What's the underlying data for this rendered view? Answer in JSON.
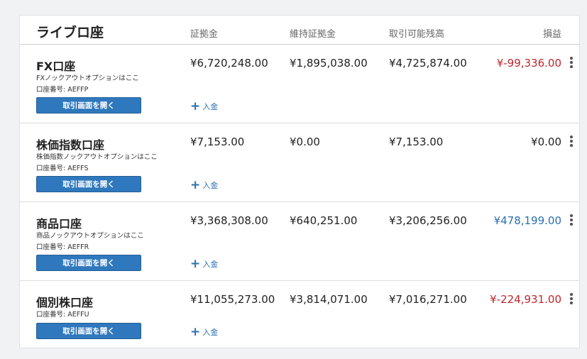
{
  "header": {
    "title": "ライブロ座",
    "col_margin": "証拠金",
    "col_maintenance": "維持証拠金",
    "col_available": "取引可能残高",
    "col_pl": "損益"
  },
  "colors": {
    "loss": "#c0262d",
    "gain": "#2a6fae",
    "neutral": "#222222",
    "button": "#2f78bd"
  },
  "accounts": [
    {
      "name": "FX口座",
      "description": "FXノックアウトオプションはここ",
      "account_number": "口座番号: AEFFP",
      "margin": "¥6,720,248.00",
      "maintenance_margin": "¥1,895,038.00",
      "available": "¥4,725,874.00",
      "pl": "¥-99,336.00",
      "pl_status": "loss",
      "open_button": "取引画面を開く",
      "deposit": "入金"
    },
    {
      "name": "株価指数口座",
      "description": "株価指数ノックアウトオプションはここ",
      "account_number": "口座番号: AEFFS",
      "margin": "¥7,153.00",
      "maintenance_margin": "¥0.00",
      "available": "¥7,153.00",
      "pl": "¥0.00",
      "pl_status": "neutral",
      "open_button": "取引画面を開く",
      "deposit": "入金"
    },
    {
      "name": "商品口座",
      "description": "商品ノックアウトオプションはここ",
      "account_number": "口座番号: AEFFR",
      "margin": "¥3,368,308.00",
      "maintenance_margin": "¥640,251.00",
      "available": "¥3,206,256.00",
      "pl": "¥478,199.00",
      "pl_status": "gain",
      "open_button": "取引画面を開く",
      "deposit": "入金"
    },
    {
      "name": "個別株口座",
      "description": "",
      "account_number": "口座番号: AEFFU",
      "margin": "¥11,055,273.00",
      "maintenance_margin": "¥3,814,071.00",
      "available": "¥7,016,271.00",
      "pl": "¥-224,931.00",
      "pl_status": "loss",
      "open_button": "取引画面を開く",
      "deposit": "入金"
    }
  ],
  "icons": {
    "deposit": "plus-icon",
    "menu": "kebab-icon"
  }
}
